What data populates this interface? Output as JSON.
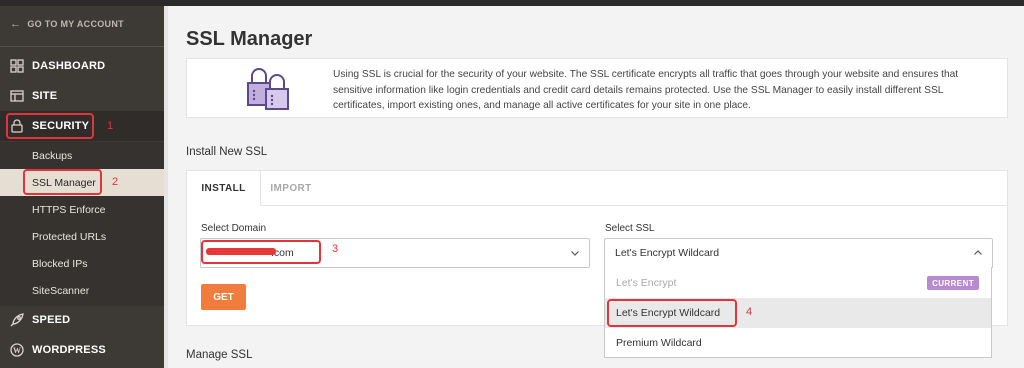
{
  "sidebar": {
    "goto_account": "GO TO MY ACCOUNT",
    "items": [
      {
        "label": "DASHBOARD",
        "icon": "grid-icon"
      },
      {
        "label": "SITE",
        "icon": "site-icon"
      },
      {
        "label": "SECURITY",
        "icon": "lock-icon"
      },
      {
        "label": "SPEED",
        "icon": "rocket-icon"
      },
      {
        "label": "WORDPRESS",
        "icon": "wordpress-icon"
      }
    ],
    "security_sub": [
      "Backups",
      "SSL Manager",
      "HTTPS Enforce",
      "Protected URLs",
      "Blocked IPs",
      "SiteScanner"
    ]
  },
  "page": {
    "title": "SSL Manager",
    "info": "Using SSL is crucial for the security of your website. The SSL certificate encrypts all traffic that goes through your website and ensures that sensitive information like login credentials and credit card details remains protected. Use the SSL Manager to easily install different SSL certificates, import existing ones, and manage all active certificates for your site in one place.",
    "install_heading": "Install New SSL",
    "manage_heading": "Manage SSL"
  },
  "install": {
    "tabs": [
      "INSTALL",
      "IMPORT"
    ],
    "domain_label": "Select Domain",
    "domain_value": ".com",
    "ssl_label": "Select SSL",
    "ssl_value": "Let's Encrypt Wildcard",
    "get_button": "GET",
    "options": [
      {
        "label": "Let's Encrypt",
        "badge": "CURRENT"
      },
      {
        "label": "Let's Encrypt Wildcard"
      },
      {
        "label": "Premium Wildcard"
      }
    ]
  },
  "annotations": [
    "1",
    "2",
    "3",
    "4"
  ],
  "colors": {
    "accent": "#f07d3e",
    "annotation": "#e0353a",
    "badge": "#b88bd1",
    "sidebar": "#3d3a36"
  }
}
